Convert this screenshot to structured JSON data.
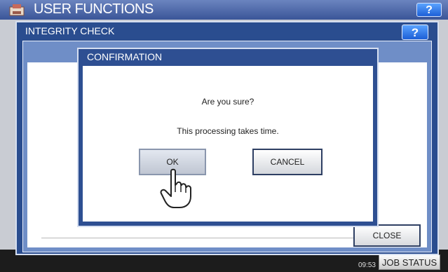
{
  "app": {
    "title": "USER FUNCTIONS",
    "help_label": "?"
  },
  "window": {
    "title": "INTEGRITY CHECK",
    "help_label": "?",
    "close_label": "CLOSE"
  },
  "dialog": {
    "title": "CONFIRMATION",
    "message_question": "Are you sure?",
    "message_info": "This processing takes time.",
    "ok_label": "OK",
    "cancel_label": "CANCEL"
  },
  "statusbar": {
    "time": "09:53",
    "job_status_label": "JOB STATUS"
  },
  "colors": {
    "dialog_frame": "#2e4f92",
    "titlebar": "#3a5598",
    "help_button": "#1c5fd6"
  },
  "icons": {
    "logo": "user-functions-icon",
    "pointer": "hand-pointer-icon"
  }
}
